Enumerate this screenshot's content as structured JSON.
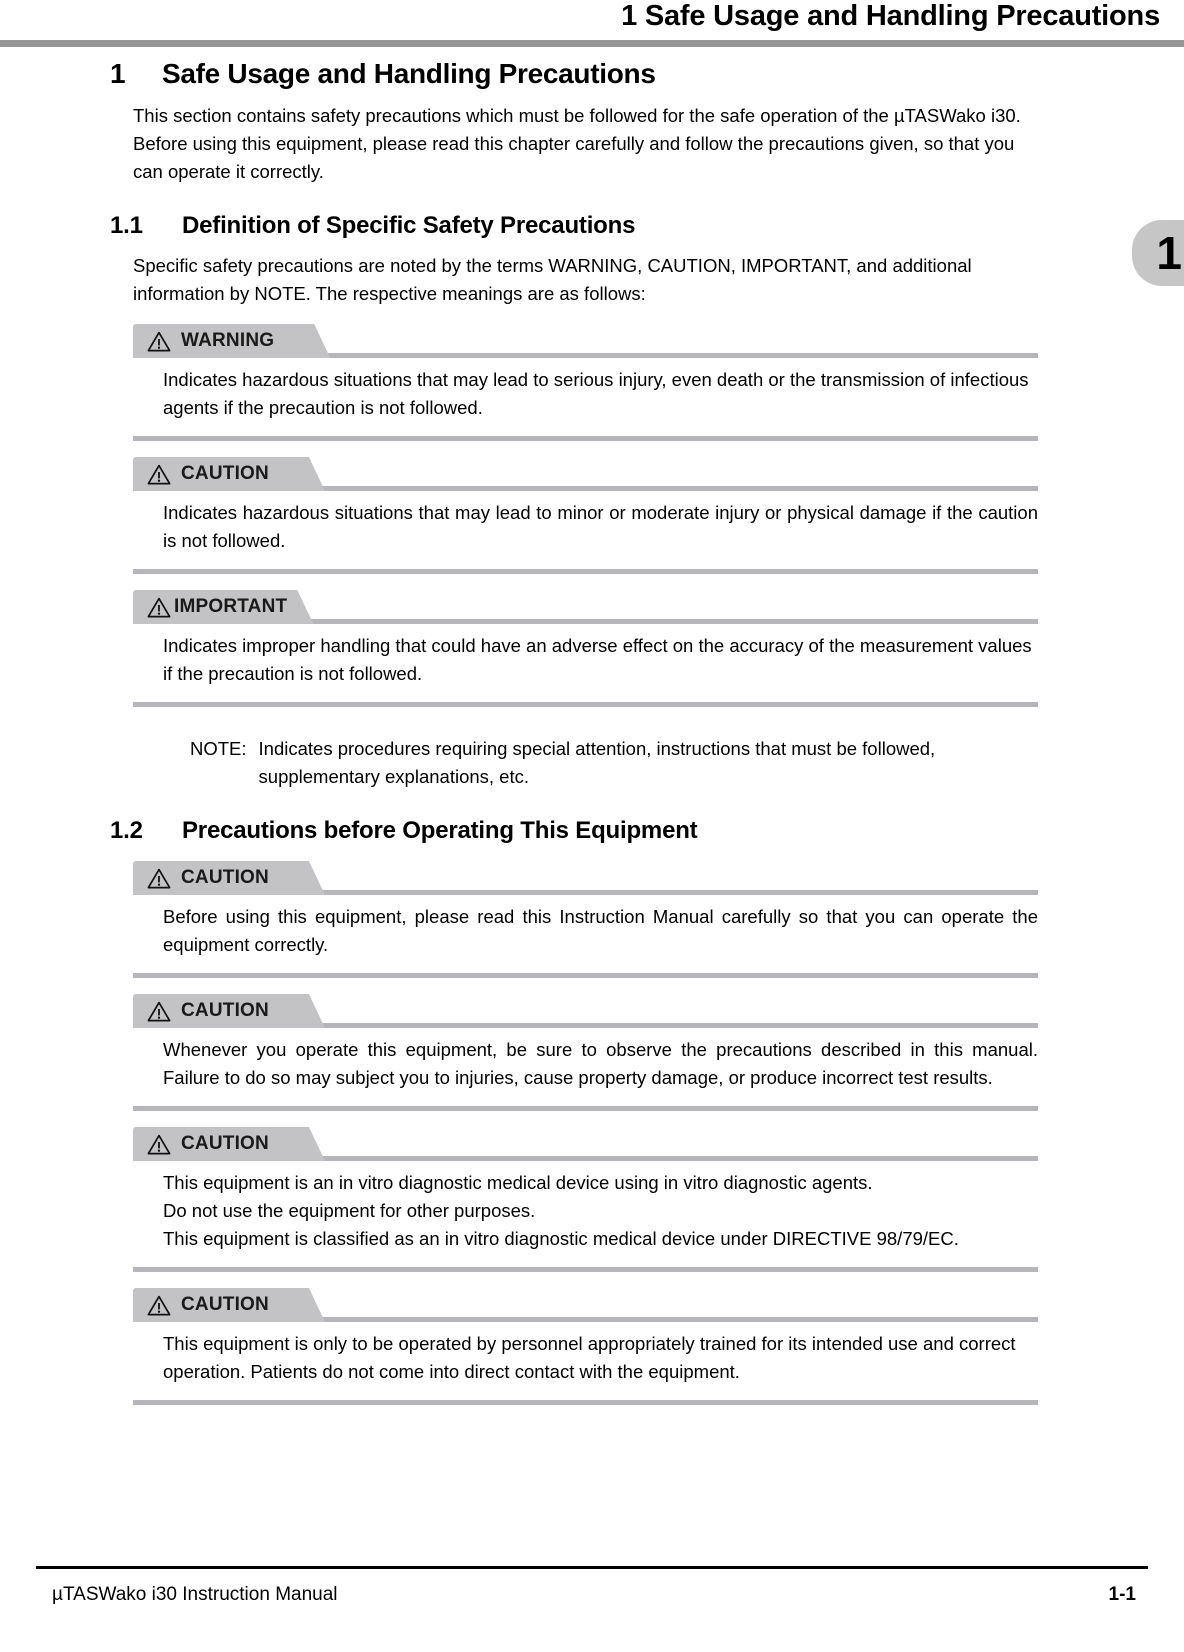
{
  "header": {
    "running_title": "1 Safe Usage and Handling Precautions"
  },
  "thumb_tab": {
    "number": "1"
  },
  "chapter": {
    "number": "1",
    "title": "Safe Usage and Handling Precautions",
    "intro": "This section contains safety precautions which must be followed for the safe operation of the µTASWako i30. Before using this equipment, please read this chapter carefully and follow the precautions given, so that you can operate it correctly."
  },
  "sections": [
    {
      "number": "1.1",
      "title": "Definition of Specific Safety Precautions",
      "intro": "Specific safety precautions are noted by the terms WARNING, CAUTION, IMPORTANT, and additional information by NOTE. The respective meanings are as follows:",
      "admonitions": [
        {
          "label": "WARNING",
          "icon": "warning-triangle-icon",
          "tab_width": "wide",
          "justify": false,
          "lines": [
            "Indicates hazardous situations that may lead to serious injury, even death or the transmission of infectious agents if the precaution is not followed."
          ]
        },
        {
          "label": "CAUTION",
          "icon": "warning-triangle-icon",
          "tab_width": "wide",
          "justify": true,
          "lines": [
            "Indicates hazardous situations that may lead to minor or moderate injury or physical damage if the caution is not followed."
          ]
        },
        {
          "label": "IMPORTANT",
          "icon": "warning-triangle-icon",
          "tab_width": "tight",
          "justify": false,
          "lines": [
            "Indicates improper handling that could have an adverse effect on the accuracy of the measurement values if the precaution is not followed."
          ]
        }
      ],
      "note": {
        "label": "NOTE:",
        "text": "Indicates procedures requiring special attention, instructions that must be followed, supplementary explanations, etc."
      }
    },
    {
      "number": "1.2",
      "title": "Precautions before Operating This Equipment",
      "admonitions": [
        {
          "label": "CAUTION",
          "icon": "warning-triangle-icon",
          "tab_width": "wide",
          "justify": true,
          "lines": [
            "Before using this equipment, please read this Instruction Manual carefully so that you can operate the equipment correctly."
          ]
        },
        {
          "label": "CAUTION",
          "icon": "warning-triangle-icon",
          "tab_width": "wide",
          "justify": true,
          "lines": [
            "Whenever you operate this equipment, be sure to observe the precautions described in this manual. Failure to do so may subject you to injuries, cause property damage, or produce incorrect test results."
          ]
        },
        {
          "label": "CAUTION",
          "icon": "warning-triangle-icon",
          "tab_width": "wide",
          "justify": false,
          "lines": [
            "This equipment is an in vitro diagnostic medical device using in vitro diagnostic agents.",
            "Do not use the equipment for other purposes.",
            "This equipment is classified as an in vitro diagnostic medical device under DIRECTIVE 98/79/EC."
          ]
        },
        {
          "label": "CAUTION",
          "icon": "warning-triangle-icon",
          "tab_width": "wide",
          "justify": false,
          "lines": [
            "This equipment is only to be operated by personnel appropriately trained for its intended use and correct operation. Patients do not come into direct contact with the equipment."
          ]
        }
      ]
    }
  ],
  "footer": {
    "left": "µTASWako i30  Instruction Manual",
    "page_number": "1-1"
  },
  "colors": {
    "header_rule": "#969696",
    "tab_gray": "#c3c3c5",
    "rule_gray": "#b5b5ba",
    "thumb_tab_gray": "#c6c6c6"
  }
}
